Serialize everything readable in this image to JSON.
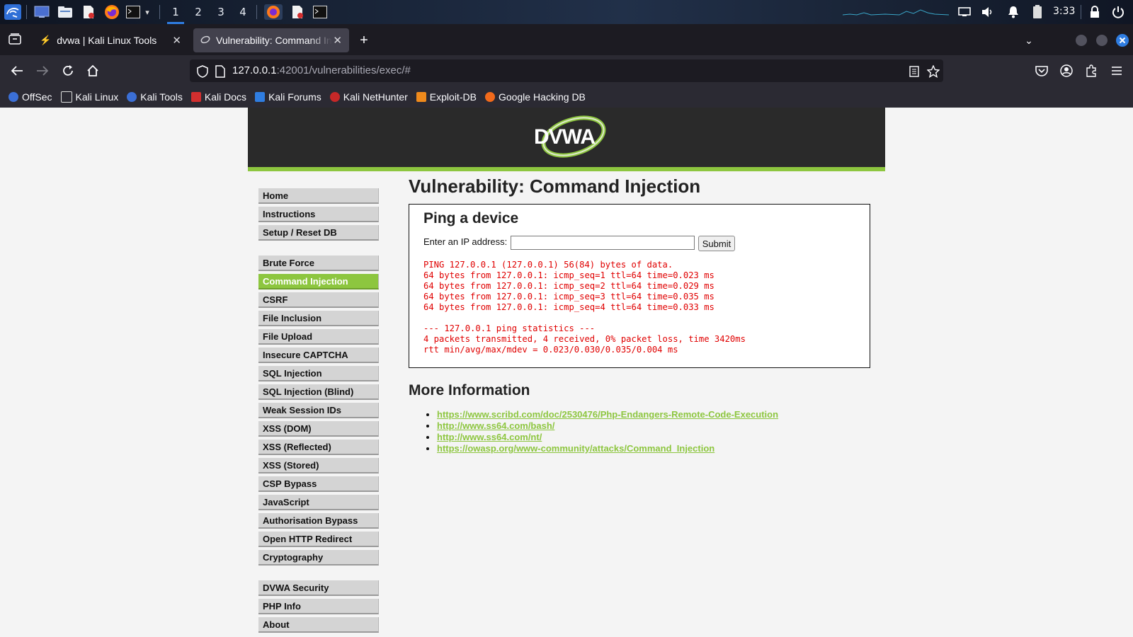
{
  "panel": {
    "workspaces": [
      "1",
      "2",
      "3",
      "4"
    ],
    "active_workspace": "1",
    "clock": "3:33",
    "icons": [
      "kali-menu-icon",
      "desktop-icon",
      "file-manager-icon",
      "text-editor-icon",
      "firefox-icon",
      "terminal-icon",
      "volume-icon",
      "notification-bell-icon",
      "battery-icon",
      "lock-icon",
      "power-icon"
    ]
  },
  "browser": {
    "tabs": [
      {
        "label": "dvwa | Kali Linux Tools",
        "active": false
      },
      {
        "label": "Vulnerability: Command Injection",
        "active": true
      }
    ],
    "url_host": "127.0.0.1",
    "url_path": ":42001/vulnerabilities/exec/#",
    "bookmarks": [
      "OffSec",
      "Kali Linux",
      "Kali Tools",
      "Kali Docs",
      "Kali Forums",
      "Kali NetHunter",
      "Exploit-DB",
      "Google Hacking DB"
    ]
  },
  "dvwa": {
    "logo_text": "DVWA",
    "menu": {
      "group1": [
        "Home",
        "Instructions",
        "Setup / Reset DB"
      ],
      "group2": [
        "Brute Force",
        "Command Injection",
        "CSRF",
        "File Inclusion",
        "File Upload",
        "Insecure CAPTCHA",
        "SQL Injection",
        "SQL Injection (Blind)",
        "Weak Session IDs",
        "XSS (DOM)",
        "XSS (Reflected)",
        "XSS (Stored)",
        "CSP Bypass",
        "JavaScript",
        "Authorisation Bypass",
        "Open HTTP Redirect",
        "Cryptography"
      ],
      "group3": [
        "DVWA Security",
        "PHP Info",
        "About"
      ],
      "selected": "Command Injection"
    },
    "page_title": "Vulnerability: Command Injection",
    "ping": {
      "title": "Ping a device",
      "ip_label": "Enter an IP address:",
      "ip_value": "",
      "submit_label": "Submit",
      "output": "PING 127.0.0.1 (127.0.0.1) 56(84) bytes of data.\n64 bytes from 127.0.0.1: icmp_seq=1 ttl=64 time=0.023 ms\n64 bytes from 127.0.0.1: icmp_seq=2 ttl=64 time=0.029 ms\n64 bytes from 127.0.0.1: icmp_seq=3 ttl=64 time=0.035 ms\n64 bytes from 127.0.0.1: icmp_seq=4 ttl=64 time=0.033 ms\n\n--- 127.0.0.1 ping statistics ---\n4 packets transmitted, 4 received, 0% packet loss, time 3420ms\nrtt min/avg/max/mdev = 0.023/0.030/0.035/0.004 ms"
    },
    "more_info": {
      "title": "More Information",
      "links": [
        "https://www.scribd.com/doc/2530476/Php-Endangers-Remote-Code-Execution",
        "http://www.ss64.com/bash/",
        "http://www.ss64.com/nt/",
        "https://owasp.org/www-community/attacks/Command_Injection"
      ]
    }
  },
  "colors": {
    "dvwa_green": "#8dc63f",
    "output_red": "#e00000",
    "firefox_bg": "#1c1b22",
    "firefox_toolbar": "#2b2a33"
  }
}
